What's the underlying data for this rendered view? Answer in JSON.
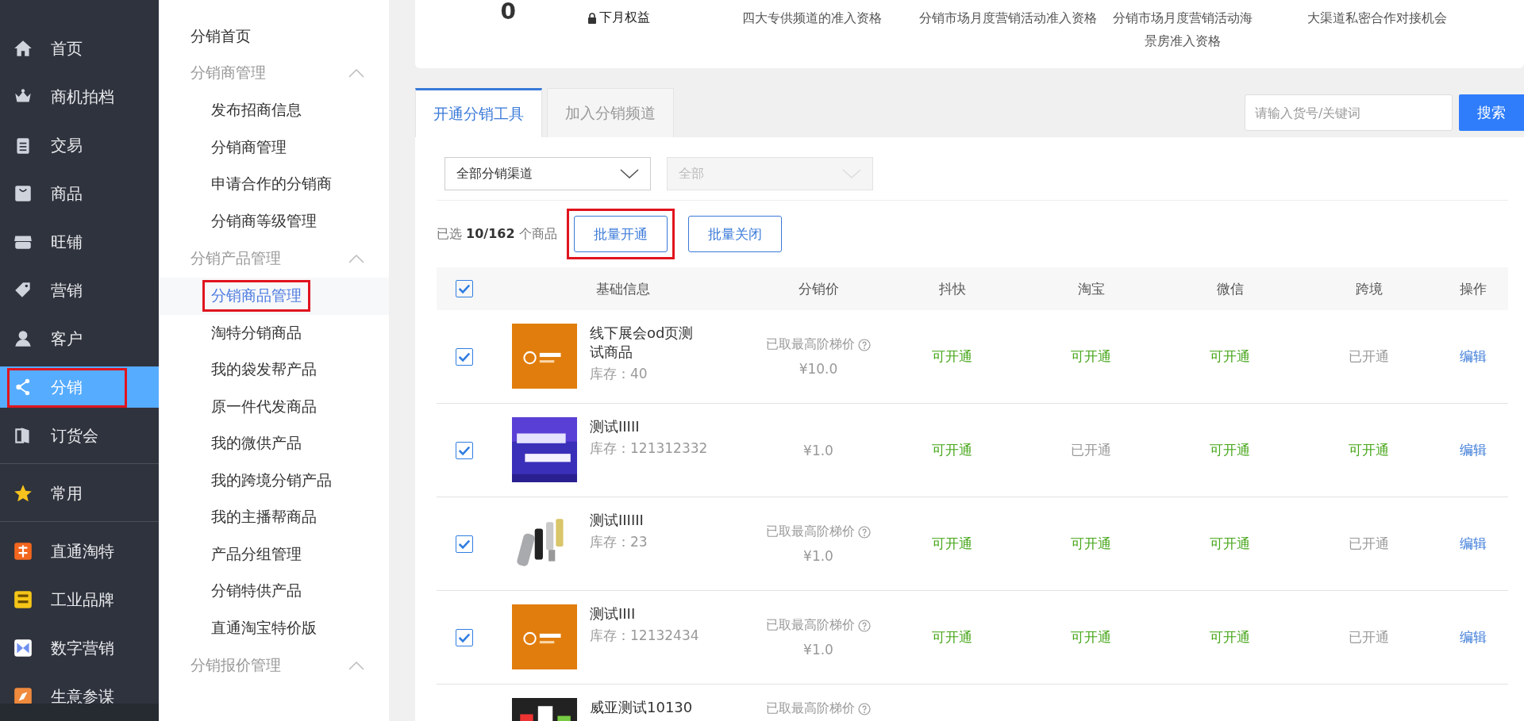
{
  "nav": {
    "groups": [
      [
        {
          "label": "首页",
          "selected": false,
          "highlighted": false
        },
        {
          "label": "商机拍档",
          "selected": false,
          "highlighted": false
        },
        {
          "label": "交易",
          "selected": false,
          "highlighted": false
        },
        {
          "label": "商品",
          "selected": false,
          "highlighted": false
        },
        {
          "label": "旺铺",
          "selected": false,
          "highlighted": false
        },
        {
          "label": "营销",
          "selected": false,
          "highlighted": false
        },
        {
          "label": "客户",
          "selected": false,
          "highlighted": false
        },
        {
          "label": "分销",
          "selected": true,
          "highlighted": true
        },
        {
          "label": "订货会",
          "selected": false,
          "highlighted": false
        }
      ],
      [
        {
          "label": "常用",
          "selected": false,
          "highlighted": false
        }
      ],
      [
        {
          "label": "直通淘特",
          "selected": false,
          "highlighted": false
        },
        {
          "label": "工业品牌",
          "selected": false,
          "highlighted": false
        },
        {
          "label": "数字营销",
          "selected": false,
          "highlighted": false
        },
        {
          "label": "生意参谋",
          "selected": false,
          "highlighted": false
        }
      ]
    ]
  },
  "submenu": [
    {
      "kind": "link",
      "label": "分销首页"
    },
    {
      "kind": "group",
      "label": "分销商管理",
      "expanded": true,
      "children": [
        {
          "label": "发布招商信息",
          "selected": false,
          "highlighted": false
        },
        {
          "label": "分销商管理",
          "selected": false,
          "highlighted": false
        },
        {
          "label": "申请合作的分销商",
          "selected": false,
          "highlighted": false
        },
        {
          "label": "分销商等级管理",
          "selected": false,
          "highlighted": false
        }
      ]
    },
    {
      "kind": "group",
      "label": "分销产品管理",
      "expanded": true,
      "children": [
        {
          "label": "分销商品管理",
          "selected": true,
          "highlighted": true
        },
        {
          "label": "淘特分销商品",
          "selected": false,
          "highlighted": false
        },
        {
          "label": "我的袋发帮产品",
          "selected": false,
          "highlighted": false
        },
        {
          "label": "原一件代发商品",
          "selected": false,
          "highlighted": false
        },
        {
          "label": "我的微供产品",
          "selected": false,
          "highlighted": false
        },
        {
          "label": "我的跨境分销产品",
          "selected": false,
          "highlighted": false
        },
        {
          "label": "我的主播帮商品",
          "selected": false,
          "highlighted": false
        },
        {
          "label": "产品分组管理",
          "selected": false,
          "highlighted": false
        },
        {
          "label": "分销特供产品",
          "selected": false,
          "highlighted": false
        },
        {
          "label": "直通淘宝特价版",
          "selected": false,
          "highlighted": false
        }
      ]
    },
    {
      "kind": "group",
      "label": "分销报价管理",
      "expanded": true
    }
  ],
  "summary": {
    "count": "0",
    "lock_label": "下月权益",
    "benefits": [
      "四大专供频道的准入资格",
      "分销市场月度营销活动准入资格",
      "分销市场月度营销活动海景房准入资格",
      "大渠道私密合作对接机会"
    ]
  },
  "tabs": [
    {
      "label": "开通分销工具",
      "selected": true
    },
    {
      "label": "加入分销频道",
      "selected": false
    }
  ],
  "search": {
    "placeholder": "请输入货号/关键词",
    "button": "搜索"
  },
  "filters": [
    {
      "value": "全部分销渠道",
      "disabled": false
    },
    {
      "value": "全部",
      "disabled": true
    }
  ],
  "selection_text": "已选 **10/162** 个商品",
  "bulk_buttons": [
    {
      "label": "批量开通",
      "highlighted": true
    },
    {
      "label": "批量关闭",
      "highlighted": false
    }
  ],
  "table": {
    "all_checked": true,
    "columns": [
      "基础信息",
      "分销价",
      "抖快",
      "淘宝",
      "微信",
      "跨境",
      "操作"
    ],
    "rows": [
      {
        "checked": true,
        "name": "线下展会od页测试商品",
        "stock": "库存：40",
        "price_note": "已取最高阶梯价",
        "price": "¥10.0",
        "channels": [
          {
            "status": "可开通",
            "available": true
          },
          {
            "status": "可开通",
            "available": true
          },
          {
            "status": "可开通",
            "available": true
          },
          {
            "status": "已开通",
            "available": false
          }
        ],
        "action": "编辑"
      },
      {
        "checked": true,
        "name": "测试IIIII",
        "stock": "库存：121312332",
        "price": "¥1.0",
        "channels": [
          {
            "status": "可开通",
            "available": true
          },
          {
            "status": "已开通",
            "available": false
          },
          {
            "status": "可开通",
            "available": true
          },
          {
            "status": "可开通",
            "available": true
          }
        ],
        "action": "编辑"
      },
      {
        "checked": true,
        "name": "测试IIIIII",
        "stock": "库存：23",
        "price_note": "已取最高阶梯价",
        "price": "¥1.0",
        "channels": [
          {
            "status": "可开通",
            "available": true
          },
          {
            "status": "可开通",
            "available": true
          },
          {
            "status": "可开通",
            "available": true
          },
          {
            "status": "已开通",
            "available": false
          }
        ],
        "action": "编辑"
      },
      {
        "checked": true,
        "name": "测试IIII",
        "stock": "库存：12132434",
        "price_note": "已取最高阶梯价",
        "price": "¥1.0",
        "channels": [
          {
            "status": "可开通",
            "available": true
          },
          {
            "status": "可开通",
            "available": true
          },
          {
            "status": "可开通",
            "available": true
          },
          {
            "status": "已开通",
            "available": false
          }
        ],
        "action": "编辑"
      },
      {
        "name": "威亚测试10130",
        "price_note": "已取最高阶梯价"
      }
    ]
  }
}
